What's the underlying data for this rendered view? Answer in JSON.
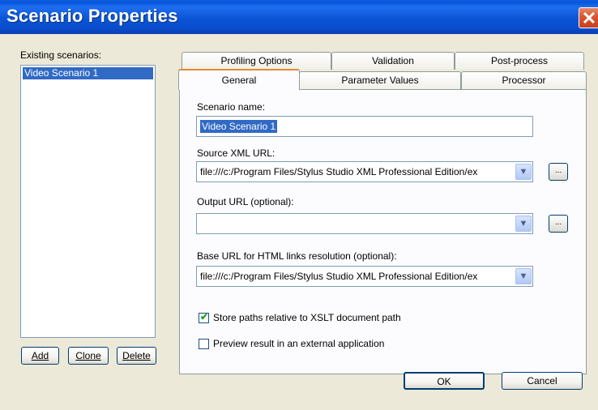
{
  "window": {
    "title": "Scenario Properties",
    "close_glyph": "✕"
  },
  "scenarios": {
    "label": "Existing scenarios:",
    "items": [
      "Video Scenario 1"
    ],
    "buttons": {
      "add": "Add",
      "clone": "Clone",
      "delete": "Delete"
    }
  },
  "tabs": {
    "row1": [
      "Profiling Options",
      "Validation",
      "Post-process"
    ],
    "row2": [
      "General",
      "Parameter Values",
      "Processor"
    ],
    "active": "General"
  },
  "general": {
    "scenario_name_label": "Scenario name:",
    "scenario_name_value": "Video Scenario 1",
    "source_label": "Source XML URL:",
    "source_value": "file:///c:/Program Files/Stylus Studio XML Professional Edition/ex",
    "output_label": "Output URL (optional):",
    "output_value": "",
    "base_label": "Base URL for HTML links resolution (optional):",
    "base_value": "file:///c:/Program Files/Stylus Studio XML Professional Edition/ex",
    "store_paths_label": "Store paths relative to XSLT document path",
    "store_paths_checked": true,
    "preview_label": "Preview result in an external application",
    "preview_checked": false,
    "browse_label": "..."
  },
  "footer": {
    "ok": "OK",
    "cancel": "Cancel"
  },
  "icons": {
    "dropdown": "chevron-down-icon",
    "check": "checkmark-icon",
    "close": "close-icon"
  },
  "colors": {
    "titlebar": "#0a55d6",
    "selection": "#316ac5",
    "tab_accent": "#e68b2c",
    "window_bg": "#ece9d8"
  }
}
